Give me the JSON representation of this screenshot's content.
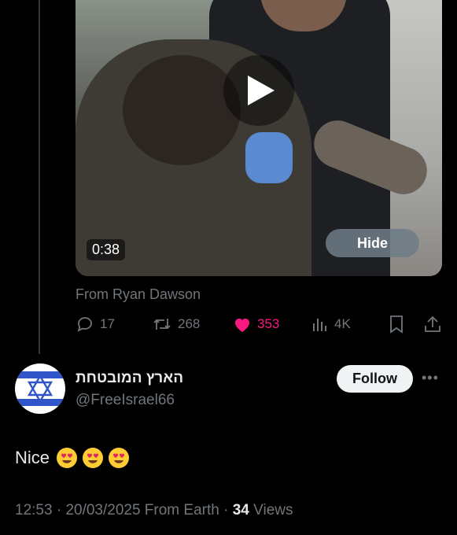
{
  "video": {
    "duration": "0:38",
    "hide_label": "Hide"
  },
  "attribution": "From Ryan Dawson",
  "actions": {
    "replies": "17",
    "reposts": "268",
    "likes": "353",
    "views": "4K"
  },
  "reply": {
    "display_name": "הארץ המובטחת",
    "handle": "@FreeIsrael66",
    "follow_label": "Follow",
    "more_label": "•••",
    "text": "Nice",
    "emoji_count": 3
  },
  "meta": {
    "time": "12:53",
    "sep1": " · ",
    "date": "20/03/2025",
    "source": " From Earth",
    "sep2": " · ",
    "views_count": "34",
    "views_label": " Views"
  },
  "colors": {
    "like": "#f91880",
    "muted": "#71767b",
    "flag_blue": "#2f55c8",
    "emoji_yellow": "#ffcc33",
    "emoji_heart": "#e0245e"
  }
}
